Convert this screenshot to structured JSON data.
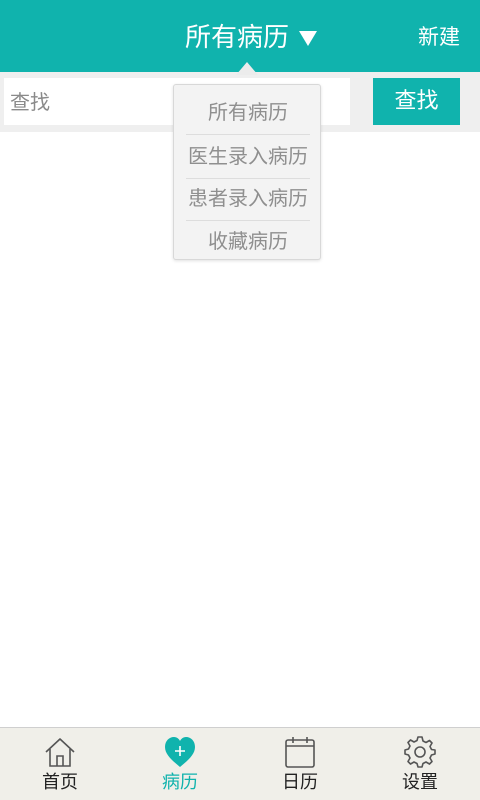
{
  "colors": {
    "primary": "#10b3ad",
    "background": "#ffffff",
    "search_bar_bg": "#efefef",
    "dropdown_bg": "#f3f3f3",
    "dropdown_text": "#8f8f8f",
    "nav_bg": "#f0efe9"
  },
  "header": {
    "title": "所有病历",
    "title_icon": "triangle-down-icon",
    "new_label": "新建"
  },
  "search": {
    "placeholder": "查找",
    "value": "",
    "button_label": "查找"
  },
  "dropdown": {
    "items": [
      {
        "label": "所有病历"
      },
      {
        "label": "医生录入病历"
      },
      {
        "label": "患者录入病历"
      },
      {
        "label": "收藏病历"
      }
    ]
  },
  "bottom_nav": {
    "items": [
      {
        "label": "首页",
        "icon": "home-icon",
        "active": false
      },
      {
        "label": "病历",
        "icon": "heart-plus-icon",
        "active": true
      },
      {
        "label": "日历",
        "icon": "calendar-icon",
        "active": false
      },
      {
        "label": "设置",
        "icon": "gear-icon",
        "active": false
      }
    ]
  }
}
